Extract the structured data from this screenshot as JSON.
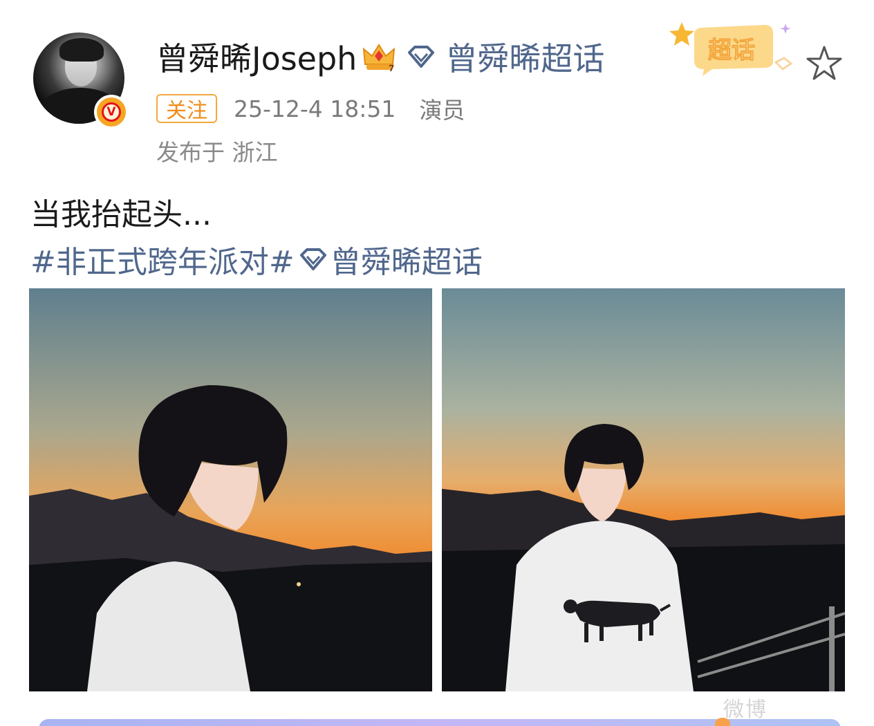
{
  "post": {
    "author": {
      "name": "曾舜晞Joseph",
      "verified": true,
      "verified_badge": "V",
      "super_topic": "曾舜晞超话",
      "super_topic_badge": "超话"
    },
    "follow_label": "关注",
    "timestamp": "25-12-4 18:51",
    "source": "演员",
    "location": "发布于 浙江",
    "text": "当我抬起头...",
    "hashtag": "#非正式跨年派对#",
    "hashtag_supertopic": "曾舜晞超话",
    "images_count": 2
  },
  "watermark": "微博",
  "colors": {
    "link_blue": "#50678c",
    "follow_orange": "#f08c1a",
    "meta_gray": "#7a7a7a",
    "verified_gold": "#f5a623"
  },
  "icons": [
    "crown-icon",
    "gem-icon",
    "chaohua-badge-icon",
    "star-icon",
    "verified-v-icon"
  ]
}
